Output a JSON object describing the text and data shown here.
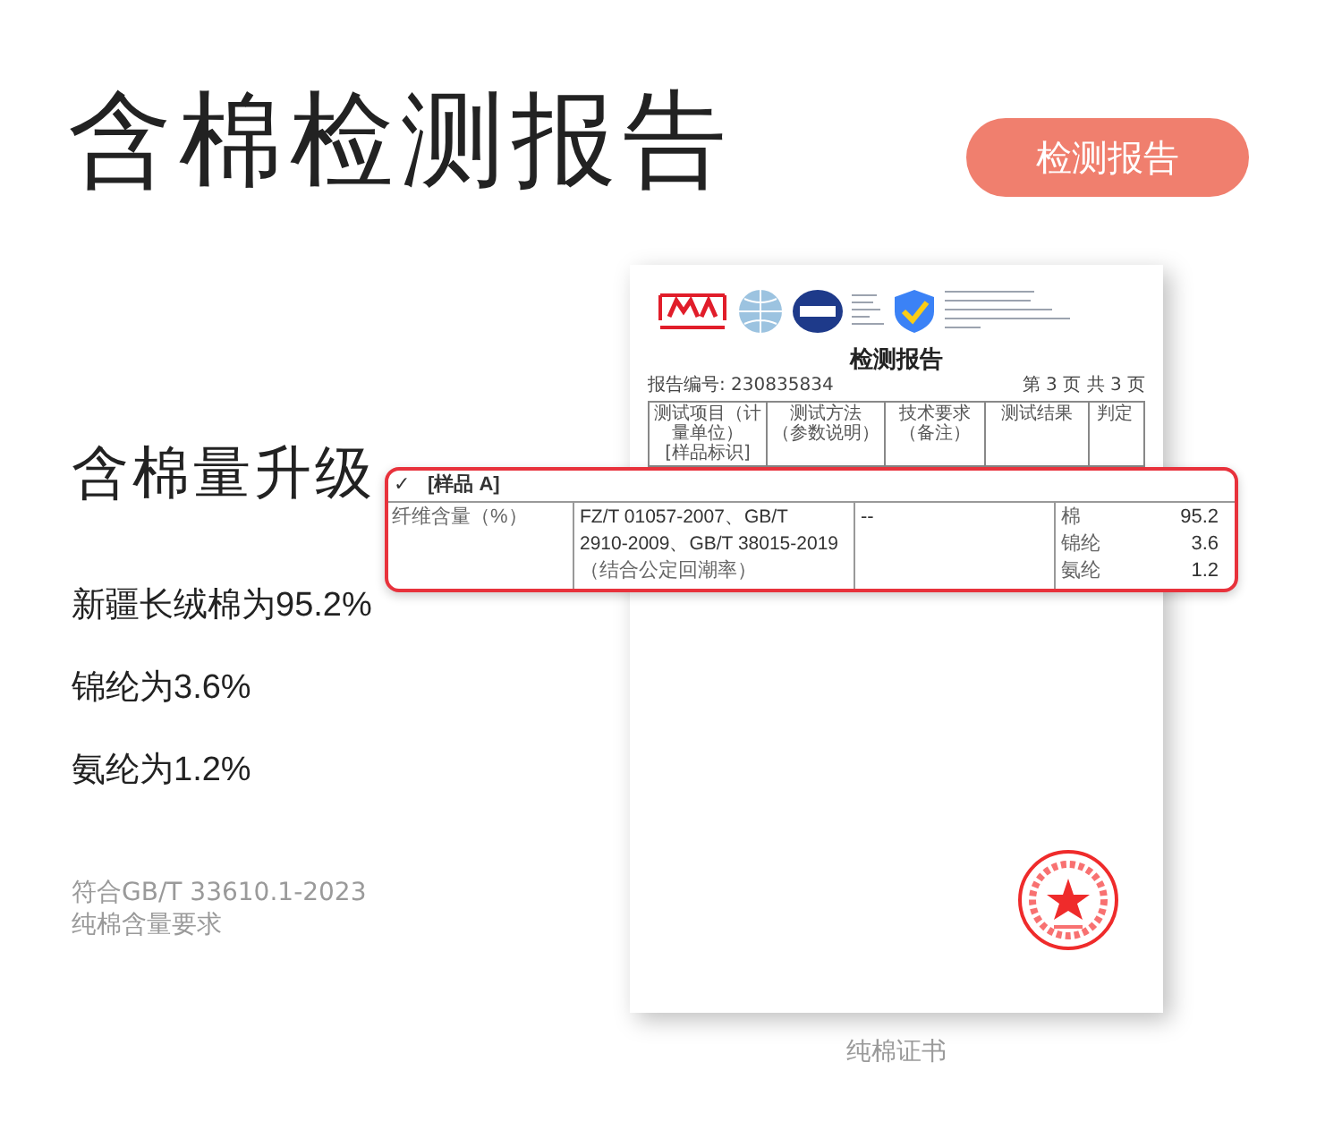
{
  "heading": "含棉检测报告",
  "badge": "检测报告",
  "subheading": "含棉量升级",
  "facts": [
    "新疆长绒棉为95.2%",
    "锦纶为3.6%",
    "氨纶为1.2%"
  ],
  "note": [
    "符合GB/T 33610.1-2023",
    "纯棉含量要求"
  ],
  "document": {
    "title": "检测报告",
    "report_no": "报告编号: 230835834",
    "page": "第 3 页 共 3 页",
    "columns": [
      [
        "测试项目（计量单位）",
        "[样品标识]"
      ],
      [
        "测试方法",
        "（参数说明）"
      ],
      [
        "技术要求",
        "（备注）"
      ],
      [
        "测试结果"
      ],
      [
        "判定"
      ]
    ]
  },
  "highlight": {
    "check": "✓",
    "sample": "[样品 A]",
    "item": "纤维含量（%）",
    "method": [
      "FZ/T 01057-2007、GB/T",
      "2910-2009、GB/T 38015-2019",
      "（结合公定回潮率）"
    ],
    "requirement": "--",
    "results": [
      {
        "name": "棉",
        "value": "95.2"
      },
      {
        "name": "锦纶",
        "value": "3.6"
      },
      {
        "name": "氨纶",
        "value": "1.2"
      }
    ]
  },
  "caption": "纯棉证书"
}
